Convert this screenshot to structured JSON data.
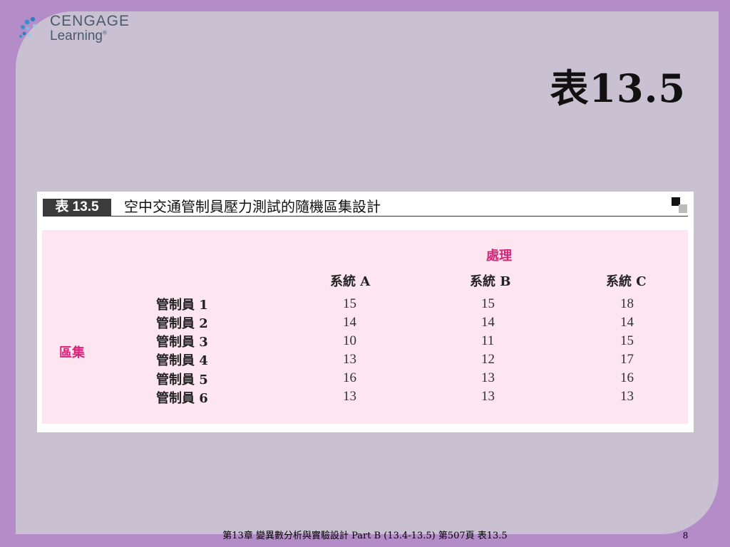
{
  "logo": {
    "word1": "CENGAGE",
    "word2": "Learning",
    "mark": "®"
  },
  "slide": {
    "title": "表13.5",
    "page_number": "8",
    "footer": "第13章  變異數分析與實驗設計  Part B (13.4-13.5)  第507頁  表13.5"
  },
  "table": {
    "label": "表 13.5",
    "caption": "空中交通管制員壓力測試的隨機區集設計",
    "group_header": "處理",
    "block_header": "區集",
    "columns": [
      "系統 A",
      "系統 B",
      "系統 C"
    ],
    "rows": [
      {
        "label": "管制員 1",
        "values": [
          "15",
          "15",
          "18"
        ]
      },
      {
        "label": "管制員 2",
        "values": [
          "14",
          "14",
          "14"
        ]
      },
      {
        "label": "管制員 3",
        "values": [
          "10",
          "11",
          "15"
        ]
      },
      {
        "label": "管制員 4",
        "values": [
          "13",
          "12",
          "17"
        ]
      },
      {
        "label": "管制員 5",
        "values": [
          "16",
          "13",
          "16"
        ]
      },
      {
        "label": "管制員 6",
        "values": [
          "13",
          "13",
          "13"
        ]
      }
    ]
  },
  "colors": {
    "background": "#b48cc8",
    "panel": "#c9c1d1",
    "table_fill": "#fde6ef",
    "accent": "#d8247a"
  }
}
